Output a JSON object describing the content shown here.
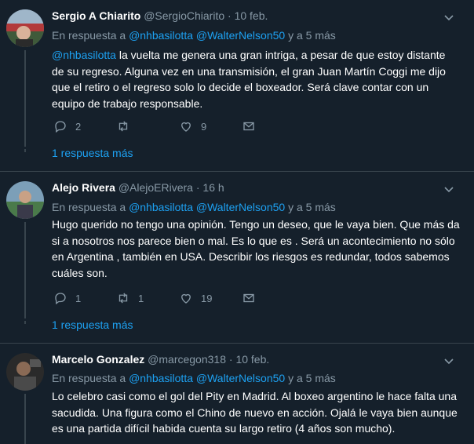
{
  "tweets": [
    {
      "name": "Sergio A Chiarito",
      "handle": "@SergioChiarito",
      "time": "10 feb.",
      "reply_prefix": "En respuesta a",
      "reply_to": "@nhbasilotta @WalterNelson50",
      "reply_suffix": "y a 5 más",
      "mention": "@nhbasilotta",
      "text": " la vuelta me genera una gran intriga, a pesar de que estoy distante de su regreso. Alguna vez en una transmisión, el gran Juan Martín Coggi me dijo que el retiro o el regreso solo lo decide el boxeador.  Será clave contar con un equipo de trabajo responsable.",
      "replies": "2",
      "retweets": "",
      "likes": "9",
      "more": "1 respuesta más"
    },
    {
      "name": "Alejo Rivera",
      "handle": "@AlejoERivera",
      "time": "16 h",
      "reply_prefix": "En respuesta a",
      "reply_to": "@nhbasilotta @WalterNelson50",
      "reply_suffix": "y a 5 más",
      "text": "Hugo querido no tengo una opinión. Tengo un deseo, que le vaya bien. Que más da si a nosotros nos parece bien o mal. Es lo que es . Será un acontecimiento no sólo en Argentina , también en USA. Describir los riesgos es redundar, todos sabemos cuáles son.",
      "replies": "1",
      "retweets": "1",
      "likes": "19",
      "more": "1 respuesta más"
    },
    {
      "name": "Marcelo Gonzalez",
      "handle": "@marcegon318",
      "time": "10 feb.",
      "reply_prefix": "En respuesta a",
      "reply_to": "@nhbasilotta @WalterNelson50",
      "reply_suffix": "y a 5 más",
      "text": "Lo celebro casi como el gol del Pity en Madrid. Al boxeo argentino le hace falta una sacudida. Una figura como el Chino de nuevo en acción. Ojalá le vaya bien aunque es una partida difícil habida cuenta su largo retiro (4 años son mucho)."
    }
  ],
  "separator": "·",
  "colors": {
    "background": "#15202b",
    "link": "#1da1f2",
    "muted": "#8899a6",
    "divider": "#38444d"
  }
}
